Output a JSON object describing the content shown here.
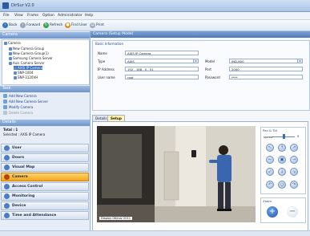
{
  "window": {
    "title": "DirSur V2.0"
  },
  "menu": [
    "File",
    "View",
    "Frame",
    "Option",
    "Administrator",
    "Help"
  ],
  "toolbar": {
    "back": "Back",
    "forward": "Forward",
    "refresh": "Refresh",
    "find_user": "Find User",
    "print": "Print"
  },
  "sidebar": {
    "cameras_title": "Camera",
    "tree": [
      {
        "label": "Camera",
        "indent": 0
      },
      {
        "label": "New Camera Group",
        "indent": 1
      },
      {
        "label": "New Camera Group(1)",
        "indent": 1
      },
      {
        "label": "Samsung Camera Server",
        "indent": 1
      },
      {
        "label": "Axis Camera Server",
        "indent": 1
      },
      {
        "label": "AXIS IP Camera",
        "indent": 2,
        "selected": true
      },
      {
        "label": "SNP-1004",
        "indent": 2
      },
      {
        "label": "SNP-3120VH",
        "indent": 2
      }
    ],
    "task_title": "Task",
    "tasks": [
      {
        "label": "Add New Camera",
        "enabled": true
      },
      {
        "label": "Add New Camera Server",
        "enabled": true
      },
      {
        "label": "Modify Camera",
        "enabled": true
      },
      {
        "label": "Delete Camera",
        "enabled": false
      }
    ],
    "details_title": "Details",
    "details": [
      "Total : 1",
      "Selected : AXIS IP Camera"
    ],
    "nav": [
      {
        "label": "User",
        "active": false
      },
      {
        "label": "Doors",
        "active": false
      },
      {
        "label": "Visual Map",
        "active": false
      },
      {
        "label": "Camera",
        "active": true
      },
      {
        "label": "Access Control",
        "active": false
      },
      {
        "label": "Monitoring",
        "active": false
      },
      {
        "label": "Device",
        "active": false
      },
      {
        "label": "Time and Attendance",
        "active": false
      }
    ]
  },
  "main": {
    "panel_title": "Camera (Setup Mode)",
    "basic_info_title": "Basic Information",
    "fields": {
      "name_label": "Name",
      "name_value": "AXIS IP Camera",
      "type_label": "Type",
      "type_value": "AXIS",
      "ip_label": "IP Address",
      "ip_value": "192 . 168 . 0 . 51",
      "username_label": "User name",
      "username_value": "root",
      "model_label": "Model",
      "model_value": "IND-800",
      "port_label": "Port",
      "port_value": "2000",
      "password_label": "Password",
      "password_value": "****"
    },
    "tabs": [
      {
        "label": "Details",
        "active": false
      },
      {
        "label": "Setup",
        "active": true
      }
    ],
    "video_caption": "Display 06/nov 2011",
    "ptz": {
      "title": "Pan & Tilt",
      "speed_label": "speed",
      "speed_value": "5",
      "speed_fraction": 0.5
    },
    "zoom": {
      "title": "Zoom"
    }
  },
  "colors": {
    "accent": "#3b6fc4",
    "active_nav": "#f2a71e",
    "header": "#4f78b5"
  }
}
